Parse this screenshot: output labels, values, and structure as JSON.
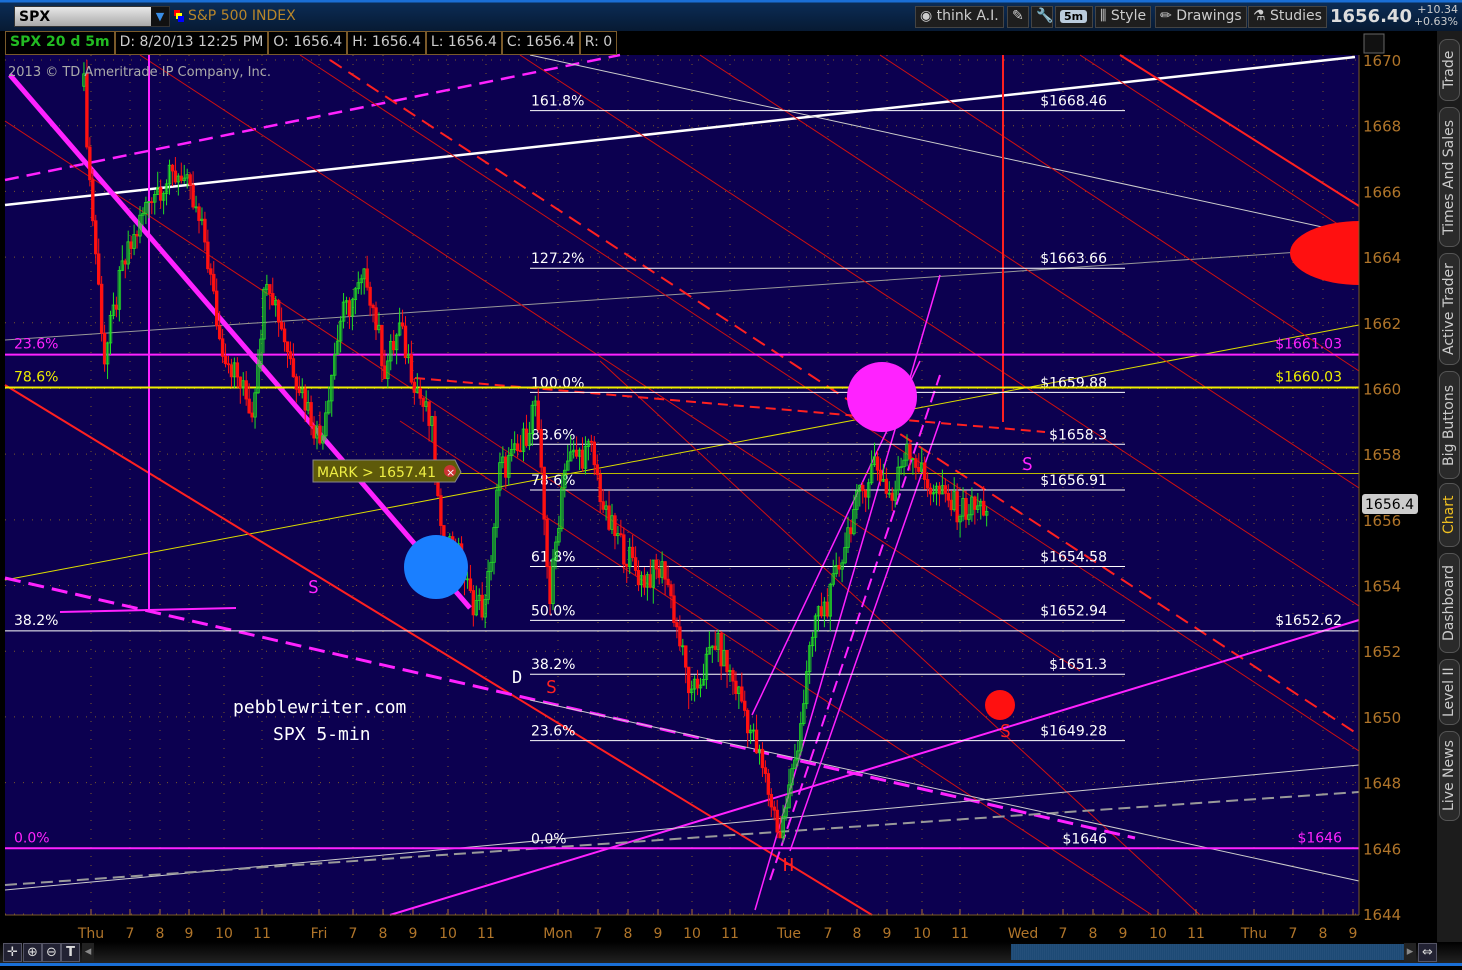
{
  "header": {
    "symbol": "SPX",
    "description": "S&P 500 INDEX",
    "buttons": {
      "think": "think A.I.",
      "aggregation": "5m",
      "style": "Style",
      "drawings": "Drawings",
      "studies": "Studies"
    },
    "last": "1656.40",
    "change": "+10.34",
    "change_pct": "+0.63%"
  },
  "infobar": {
    "title": "SPX 20 d 5m",
    "date": "D: 8/20/13 12:25 PM",
    "open": "O: 1656.4",
    "high": "H: 1656.4",
    "low": "L: 1656.4",
    "close": "C: 1656.4",
    "range": "R: 0"
  },
  "copyright": "2013 © TD Ameritrade IP Company, Inc.",
  "side_tabs": [
    "Trade",
    "Times And Sales",
    "Active Trader",
    "Big Buttons",
    "Chart",
    "Dashboard",
    "Level II",
    "Live News"
  ],
  "colors": {
    "bg": "#0c0050",
    "up": "#22dd22",
    "down": "#ff1111",
    "magenta": "#ff22ff",
    "yellow": "#eeee00",
    "axis": "#b0752a"
  },
  "chart_data": {
    "type": "candlestick",
    "title": "SPX 20 d 5m",
    "ylim": [
      1644,
      1670
    ],
    "yticks": [
      1644,
      1646,
      1648,
      1650,
      1652,
      1654,
      1656,
      1658,
      1660,
      1662,
      1664,
      1666,
      1668,
      1670
    ],
    "xticks": [
      "Thu",
      "7",
      "8",
      "9",
      "10",
      "11",
      "Fri",
      "7",
      "8",
      "9",
      "10",
      "11",
      "Mon",
      "7",
      "8",
      "9",
      "10",
      "11",
      "Tue",
      "7",
      "8",
      "9",
      "10",
      "11",
      "Wed",
      "7",
      "8",
      "9",
      "10",
      "11",
      "Thu",
      "7",
      "8",
      "9"
    ],
    "price_path_bar_index": [
      1,
      3,
      8,
      14,
      24,
      34,
      42,
      47,
      58,
      63,
      71,
      81,
      88,
      97,
      103,
      108,
      114,
      119,
      122,
      127,
      132,
      137,
      142,
      149,
      154,
      159,
      164,
      173,
      178,
      190,
      198,
      207,
      215,
      224,
      231,
      237,
      242,
      249,
      254,
      261,
      269,
      275,
      280,
      286,
      293,
      298,
      307
    ],
    "price_path": [
      1669.2,
      1666.3,
      1660.9,
      1663.6,
      1666,
      1666.6,
      1664.5,
      1661.5,
      1659.3,
      1663.6,
      1660.9,
      1658.4,
      1662.1,
      1663.4,
      1660.6,
      1661.8,
      1660,
      1658.7,
      1655.4,
      1655.2,
      1653.6,
      1653.3,
      1657.5,
      1658.1,
      1659.6,
      1653.6,
      1657.8,
      1658.1,
      1656,
      1654.2,
      1654.5,
      1650.5,
      1652.3,
      1650.5,
      1648.4,
      1646.4,
      1648.7,
      1653,
      1653.6,
      1656,
      1657.8,
      1656.6,
      1658.4,
      1657.2,
      1656.6,
      1656.3,
      1656.4
    ],
    "current_price": "1656.4",
    "mark_label": "MARK > 1657.41",
    "mark_price": 1657.41,
    "fib_levels": [
      {
        "pct": "161.8%",
        "label": "$1668.46",
        "price": 1668.46
      },
      {
        "pct": "127.2%",
        "label": "$1663.66",
        "price": 1663.66
      },
      {
        "pct": "100.0%",
        "label": "$1659.88",
        "price": 1659.88
      },
      {
        "pct": "88.6%",
        "label": "$1658.3",
        "price": 1658.3
      },
      {
        "pct": "78.6%",
        "label": "$1656.91",
        "price": 1656.91
      },
      {
        "pct": "61.8%",
        "label": "$1654.58",
        "price": 1654.58
      },
      {
        "pct": "50.0%",
        "label": "$1652.94",
        "price": 1652.94
      },
      {
        "pct": "38.2%",
        "label": "$1651.3",
        "price": 1651.3
      },
      {
        "pct": "23.6%",
        "label": "$1649.28",
        "price": 1649.28
      },
      {
        "pct": "0.0%",
        "label": "$1646",
        "price": 1646
      }
    ],
    "long_levels": [
      {
        "pct": "23.6%",
        "label": "$1661.03",
        "price": 1661.03,
        "color": "#ff22ff"
      },
      {
        "pct": "78.6%",
        "label": "$1660.03",
        "price": 1660.03,
        "color": "#eeee00"
      },
      {
        "pct": "38.2%",
        "label": "$1652.62",
        "price": 1652.62,
        "color": "#ffffff"
      },
      {
        "pct": "0.0%",
        "label": "$1646",
        "price": 1646,
        "color": "#ff22ff"
      }
    ],
    "annotations": {
      "site": "pebblewriter.com",
      "subtitle": "SPX 5-min",
      "s": "S",
      "d": "D",
      "h": "H"
    }
  }
}
